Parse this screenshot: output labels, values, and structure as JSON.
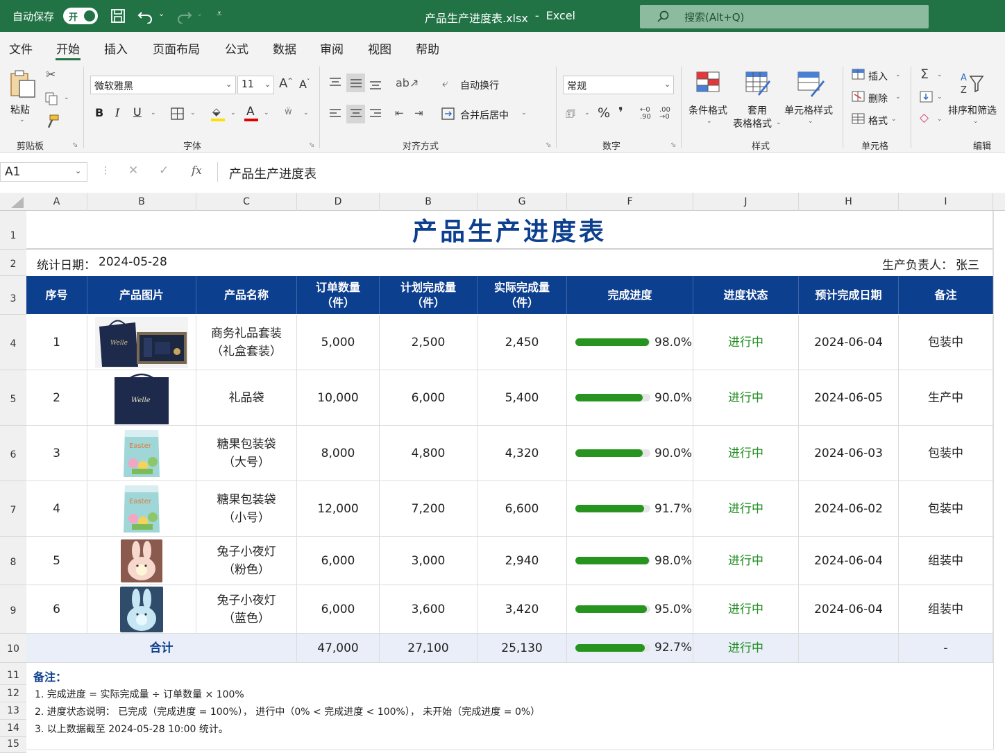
{
  "titlebar": {
    "autosave_label": "自动保存",
    "autosave_toggle": "开",
    "document_title": "产品生产进度表.xlsx",
    "separator": "-",
    "app_name": "Excel",
    "search_placeholder": "搜索(Alt+Q)"
  },
  "menu": {
    "items": [
      "文件",
      "开始",
      "插入",
      "页面布局",
      "公式",
      "数据",
      "审阅",
      "视图",
      "帮助"
    ],
    "active": "开始"
  },
  "ribbon": {
    "paste_label": "粘贴",
    "font_name": "微软雅黑",
    "font_size": "11",
    "wrap_text": "自动换行",
    "merge_center": "合并后居中",
    "number_format": "常规",
    "percent_symbol": "%",
    "comma_symbol": "❜",
    "cond_format": "条件格式",
    "table_format_l1": "套用",
    "table_format_l2": "表格格式",
    "cell_styles": "单元格样式",
    "insert": "插入",
    "delete": "删除",
    "format": "格式",
    "sort_filter": "排序和筛选",
    "groups": {
      "clipboard": "剪贴板",
      "font": "字体",
      "alignment": "对齐方式",
      "number": "数字",
      "styles": "样式",
      "cells": "单元格",
      "editing": "编辑"
    },
    "colors": {
      "font_color": "#e00000",
      "fill_color": "#ffe000"
    }
  },
  "formula_bar": {
    "name_box": "A1",
    "fx": "fx",
    "content": "产品生产进度表"
  },
  "sheet": {
    "column_headers": [
      "A",
      "B",
      "C",
      "D",
      "B",
      "G",
      "F",
      "J",
      "H",
      "I"
    ],
    "row_numbers": [
      "1",
      "2",
      "3",
      "4",
      "5",
      "6",
      "7",
      "8",
      "9",
      "10",
      "11",
      "12",
      "13",
      "14",
      "15"
    ],
    "title": "产品生产进度表",
    "stat_date_label": "统计日期：",
    "stat_date": "2024-05-28",
    "owner_label": "生产负责人：",
    "owner": "张三",
    "header": {
      "seq": "序号",
      "image": "产品图片",
      "name": "产品名称",
      "order_qty_l1": "订单数量",
      "order_qty_l2": "（件）",
      "plan_qty_l1": "计划完成量",
      "plan_qty_l2": "（件）",
      "actual_qty_l1": "实际完成量",
      "actual_qty_l2": "（件）",
      "progress": "完成进度",
      "status": "进度状态",
      "est_date": "预计完成日期",
      "remark": "备注"
    },
    "rows": [
      {
        "seq": "1",
        "image": "gift-set-image",
        "name_l1": "商务礼品套装",
        "name_l2": "（礼盒套装）",
        "order": "5,000",
        "plan": "2,500",
        "actual": "2,450",
        "progress": 0.98,
        "progress_label": "98.0%",
        "status": "进行中",
        "date": "2024-06-04",
        "remark": "包装中"
      },
      {
        "seq": "2",
        "image": "gift-bag-image",
        "name_l1": "礼品袋",
        "name_l2": "",
        "order": "10,000",
        "plan": "6,000",
        "actual": "5,400",
        "progress": 0.9,
        "progress_label": "90.0%",
        "status": "进行中",
        "date": "2024-06-05",
        "remark": "生产中"
      },
      {
        "seq": "3",
        "image": "candy-bag-large-image",
        "name_l1": "糖果包装袋",
        "name_l2": "（大号）",
        "order": "8,000",
        "plan": "4,800",
        "actual": "4,320",
        "progress": 0.9,
        "progress_label": "90.0%",
        "status": "进行中",
        "date": "2024-06-03",
        "remark": "包装中"
      },
      {
        "seq": "4",
        "image": "candy-bag-small-image",
        "name_l1": "糖果包装袋",
        "name_l2": "（小号）",
        "order": "12,000",
        "plan": "7,200",
        "actual": "6,600",
        "progress": 0.917,
        "progress_label": "91.7%",
        "status": "进行中",
        "date": "2024-06-02",
        "remark": "包装中"
      },
      {
        "seq": "5",
        "image": "bunny-lamp-pink-image",
        "name_l1": "兔子小夜灯",
        "name_l2": "（粉色）",
        "order": "6,000",
        "plan": "3,000",
        "actual": "2,940",
        "progress": 0.98,
        "progress_label": "98.0%",
        "status": "进行中",
        "date": "2024-06-04",
        "remark": "组装中"
      },
      {
        "seq": "6",
        "image": "bunny-lamp-blue-image",
        "name_l1": "兔子小夜灯",
        "name_l2": "（蓝色）",
        "order": "6,000",
        "plan": "3,600",
        "actual": "3,420",
        "progress": 0.95,
        "progress_label": "95.0%",
        "status": "进行中",
        "date": "2024-06-04",
        "remark": "组装中"
      }
    ],
    "total": {
      "label": "合计",
      "order": "47,000",
      "plan": "27,100",
      "actual": "25,130",
      "progress": 0.927,
      "progress_label": "92.7%",
      "status": "进行中",
      "date": "",
      "remark": "-"
    },
    "notes": {
      "title": "备注：",
      "lines": [
        "1. 完成进度 = 实际完成量 ÷ 订单数量 × 100%",
        "2. 进度状态说明： 已完成（完成进度 = 100%）， 进行中（0% < 完成进度 < 100%）， 未开始（完成进度 = 0%）",
        "3. 以上数据截至 2024-05-28 10:00 统计。"
      ]
    },
    "colors": {
      "header_bg": "#0d3f8f",
      "title": "#0d3f8f",
      "progress": "#26941f",
      "status": "#1e8c1e",
      "total_bg": "#e9eef8"
    }
  }
}
